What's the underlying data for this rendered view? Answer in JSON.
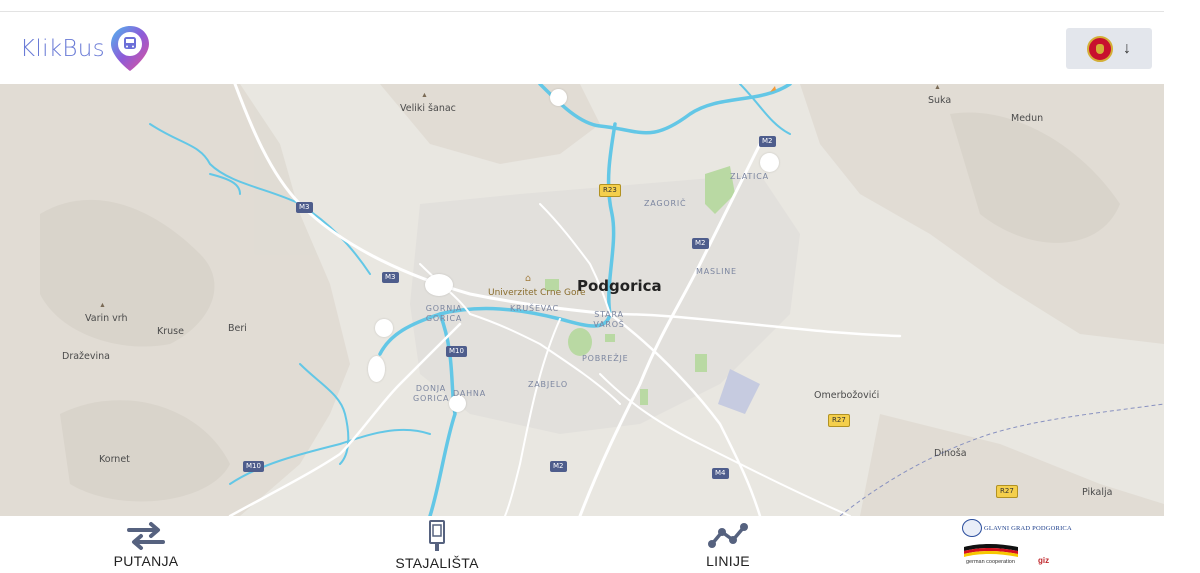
{
  "header": {
    "logo_text": "KlikBus",
    "language_selector": {
      "flag": "montenegro-flag",
      "arrow": "↓"
    }
  },
  "map": {
    "city_label": "Podgorica",
    "poi_label": "Univerzitet Crne Gore",
    "place_labels": [
      "Veliki šanac",
      "Suka",
      "Medun",
      "Varin vrh",
      "Kruse",
      "Beri",
      "Draževina",
      "Kornet",
      "Omerbožovići",
      "Dinoša",
      "Pikalja"
    ],
    "district_labels": [
      "ZLATICA",
      "ZAGORIČ",
      "MASLINE",
      "KRUŠEVAC",
      "GORNJA GORICA",
      "STARA VAROŠ",
      "POBREŽJE",
      "ZABJELO",
      "DONJA GORICA",
      "DAHNA"
    ],
    "road_shields": [
      "M2",
      "M3",
      "R23",
      "M2",
      "M3",
      "M10",
      "M10",
      "R27",
      "M2",
      "M4",
      "R27"
    ],
    "colors": {
      "land": "#e9e7e1",
      "water": "#63c7e6",
      "roads": "#ffffff",
      "parks": "#b9d9a3",
      "boundary": "#7e86b9"
    }
  },
  "bottom_nav": {
    "items": [
      {
        "label": "PUTANJA",
        "icon": "swap-arrows-icon"
      },
      {
        "label": "STAJALIŠTA",
        "icon": "bus-stop-icon"
      },
      {
        "label": "LINIJE",
        "icon": "route-line-icon"
      }
    ],
    "sponsor": {
      "city": "GLAVNI GRAD PODGORICA",
      "german_text": "german cooperation",
      "giz": "giz"
    }
  }
}
